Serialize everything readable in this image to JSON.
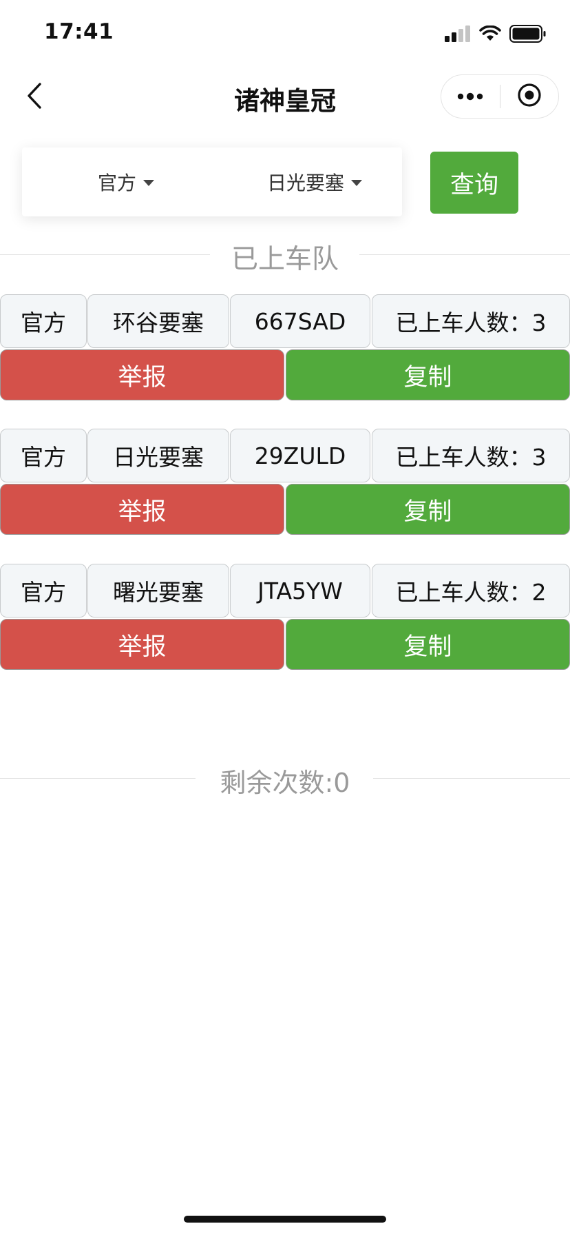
{
  "status_bar": {
    "time": "17:41"
  },
  "nav": {
    "title": "诸神皇冠"
  },
  "filter": {
    "camp_value": "官方",
    "map_value": "日光要塞",
    "query_label": "查询"
  },
  "section_title": "已上车队",
  "teams": [
    {
      "camp": "官方",
      "map": "环谷要塞",
      "code": "667SAD",
      "count_label": "已上车人数：3",
      "report_label": "举报",
      "copy_label": "复制"
    },
    {
      "camp": "官方",
      "map": "日光要塞",
      "code": "29ZULD",
      "count_label": "已上车人数：3",
      "report_label": "举报",
      "copy_label": "复制"
    },
    {
      "camp": "官方",
      "map": "曙光要塞",
      "code": "JTA5YW",
      "count_label": "已上车人数：2",
      "report_label": "举报",
      "copy_label": "复制"
    }
  ],
  "remaining": "剩余次数:0",
  "colors": {
    "accent_green": "#52aa3c",
    "report_red": "#d4514a",
    "muted_text": "#9a9a9a"
  },
  "icons": {
    "back": "chevron-left-icon",
    "more": "more-dots-icon",
    "close": "target-circle-icon",
    "signal": "signal-icon",
    "wifi": "wifi-icon",
    "battery": "battery-icon"
  }
}
